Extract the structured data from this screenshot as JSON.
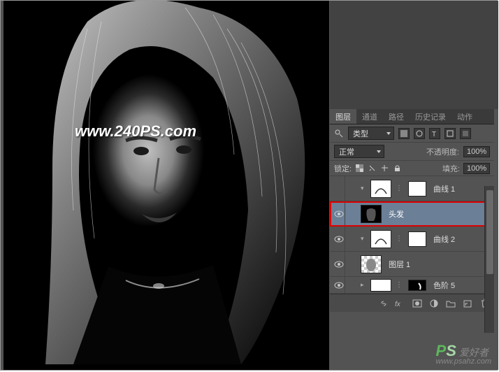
{
  "watermark": "www.240PS.com",
  "footer": {
    "ps": "P",
    "s": "S",
    "cn": "爱好者",
    "url": "www.psahz.com"
  },
  "panel": {
    "tabs": [
      "图层",
      "通道",
      "路径",
      "历史记录",
      "动作"
    ],
    "activeTab": 0,
    "kindLabel": "类型",
    "blendMode": "正常",
    "opacityLabel": "不透明度:",
    "opacityValue": "100%",
    "lockLabel": "锁定:",
    "fillLabel": "填充:",
    "fillValue": "100%",
    "layers": [
      {
        "name": "曲线 1",
        "type": "adj",
        "visible": false,
        "chev": "▾"
      },
      {
        "name": "头发",
        "type": "img-dark",
        "visible": true,
        "selected": true,
        "highlight": true
      },
      {
        "name": "曲线 2",
        "type": "adj",
        "visible": true,
        "chev": "▾"
      },
      {
        "name": "图层 1",
        "type": "img-trans",
        "visible": true
      },
      {
        "name": "色阶 5",
        "type": "adj-partial",
        "visible": true,
        "chev": "▸"
      }
    ],
    "bottomIcons": [
      "link",
      "fx",
      "mask",
      "adj",
      "group",
      "new",
      "trash"
    ]
  }
}
